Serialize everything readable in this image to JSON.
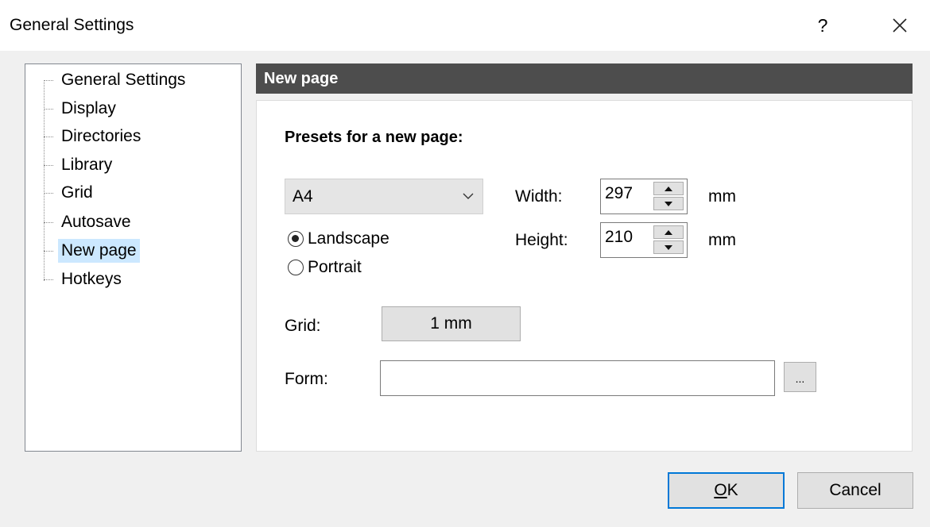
{
  "window": {
    "title": "General Settings",
    "help_label": "?",
    "close_icon": "close-icon"
  },
  "tree": {
    "items": [
      {
        "label": "General Settings",
        "selected": false
      },
      {
        "label": "Display",
        "selected": false
      },
      {
        "label": "Directories",
        "selected": false
      },
      {
        "label": "Library",
        "selected": false
      },
      {
        "label": "Grid",
        "selected": false
      },
      {
        "label": "Autosave",
        "selected": false
      },
      {
        "label": "New page",
        "selected": true
      },
      {
        "label": "Hotkeys",
        "selected": false
      }
    ]
  },
  "panel": {
    "header": "New page",
    "presets_label": "Presets for a new page:",
    "page_size": "A4",
    "width_label": "Width:",
    "width_value": "297",
    "width_unit": "mm",
    "height_label": "Height:",
    "height_value": "210",
    "height_unit": "mm",
    "orientation": {
      "landscape_label": "Landscape",
      "portrait_label": "Portrait",
      "selected": "Landscape"
    },
    "grid_label": "Grid:",
    "grid_value": "1 mm",
    "form_label": "Form:",
    "form_value": "",
    "browse_label": "..."
  },
  "footer": {
    "ok_mnemonic": "O",
    "ok_rest": "K",
    "cancel_label": "Cancel"
  },
  "colors": {
    "header_bg": "#4d4d4d",
    "selection_bg": "#cce8ff",
    "default_button_border": "#0078d7",
    "dialog_bg": "#f0f0f0"
  }
}
